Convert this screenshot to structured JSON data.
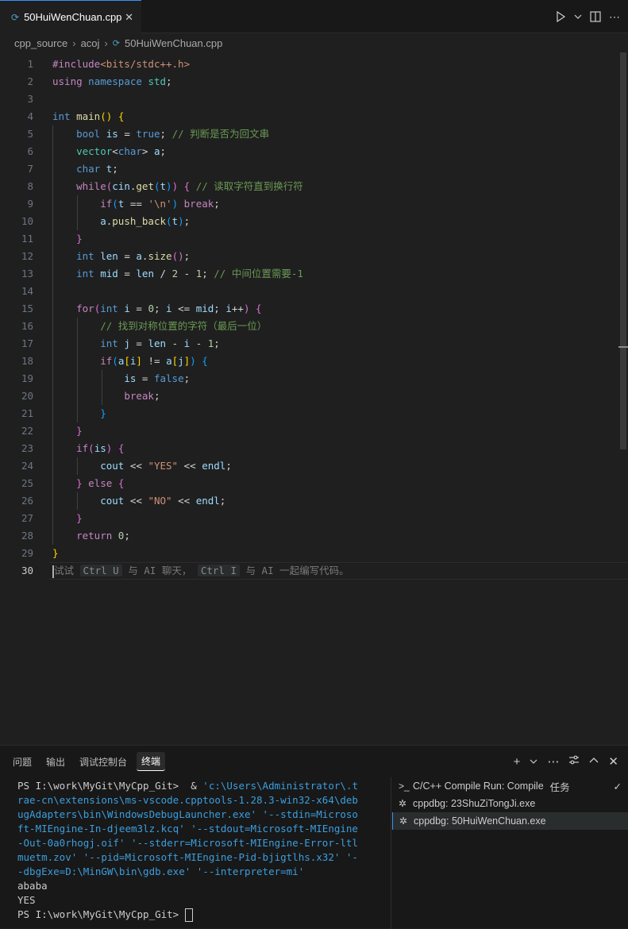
{
  "tab": {
    "filename": "50HuiWenChuan.cpp",
    "close": "✕"
  },
  "breadcrumb": [
    "cpp_source",
    "acoj",
    "50HuiWenChuan.cpp"
  ],
  "editor": {
    "current_line": 30,
    "hint": {
      "pre": "试试 ",
      "key1": "Ctrl U",
      "mid": " 与 AI 聊天， ",
      "key2": "Ctrl I",
      "post": " 与 AI 一起编写代码。"
    }
  },
  "panel": {
    "tabs": [
      "问题",
      "输出",
      "调试控制台",
      "终端"
    ],
    "active_tab": "终端",
    "terminal_lines": [
      "PS I:\\work\\MyGit\\MyCpp_Git>  & 'c:\\Users\\Administrator\\.t",
      "rae-cn\\extensions\\ms-vscode.cpptools-1.28.3-win32-x64\\deb",
      "ugAdapters\\bin\\WindowsDebugLauncher.exe' '--stdin=Microso",
      "ft-MIEngine-In-djeem3lz.kcq' '--stdout=Microsoft-MIEngine",
      "-Out-0a0rhogj.oif' '--stderr=Microsoft-MIEngine-Error-ltl",
      "muetm.zov' '--pid=Microsoft-MIEngine-Pid-bjigtlhs.x32' '-",
      "-dbgExe=D:\\MinGW\\bin\\gdb.exe' '--interpreter=mi'",
      "ababa",
      "YES",
      "PS I:\\work\\MyGit\\MyCpp_Git> "
    ],
    "tasks": [
      {
        "label": "C/C++ Compile Run: Compile",
        "tag": "任务",
        "icon": "terminal-icon",
        "check": "✓"
      },
      {
        "label": "cppdbg: 23ShuZiTongJi.exe",
        "icon": "debug-icon"
      },
      {
        "label": "cppdbg: 50HuiWenChuan.exe",
        "icon": "debug-icon"
      }
    ]
  }
}
